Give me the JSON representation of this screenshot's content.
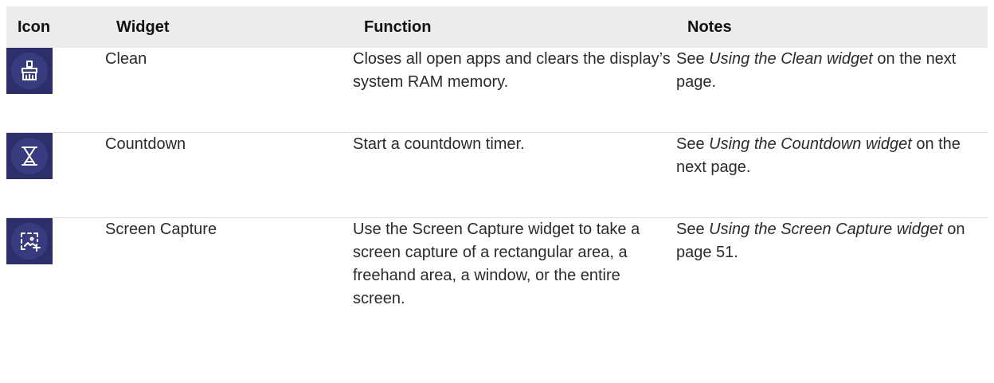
{
  "table": {
    "headers": {
      "icon": "Icon",
      "widget": "Widget",
      "function": "Function",
      "notes": "Notes"
    },
    "rows": [
      {
        "icon": "broom-icon",
        "widget": "Clean",
        "function": "Closes all open apps and clears the display’s system RAM memory.",
        "notes_prefix": "See ",
        "notes_link": "Using the Clean widget",
        "notes_suffix": " on the next page."
      },
      {
        "icon": "hourglass-icon",
        "widget": "Countdown",
        "function": "Start a countdown timer.",
        "notes_prefix": "See ",
        "notes_link": "Using the Countdown widget",
        "notes_suffix": " on the next page."
      },
      {
        "icon": "screen-capture-icon",
        "widget": "Screen Capture",
        "function": "Use the Screen Capture widget to take a screen capture of a rectangular area, a freehand area, a window, or the entire screen.",
        "notes_prefix": "See ",
        "notes_link": "Using the Screen Capture widget",
        "notes_suffix": " on page 51."
      }
    ],
    "colors": {
      "header_bg": "#ececec",
      "icon_bg": "#2d2f6b",
      "icon_circle": "#383b7e",
      "icon_glyph": "#ffffff"
    }
  }
}
